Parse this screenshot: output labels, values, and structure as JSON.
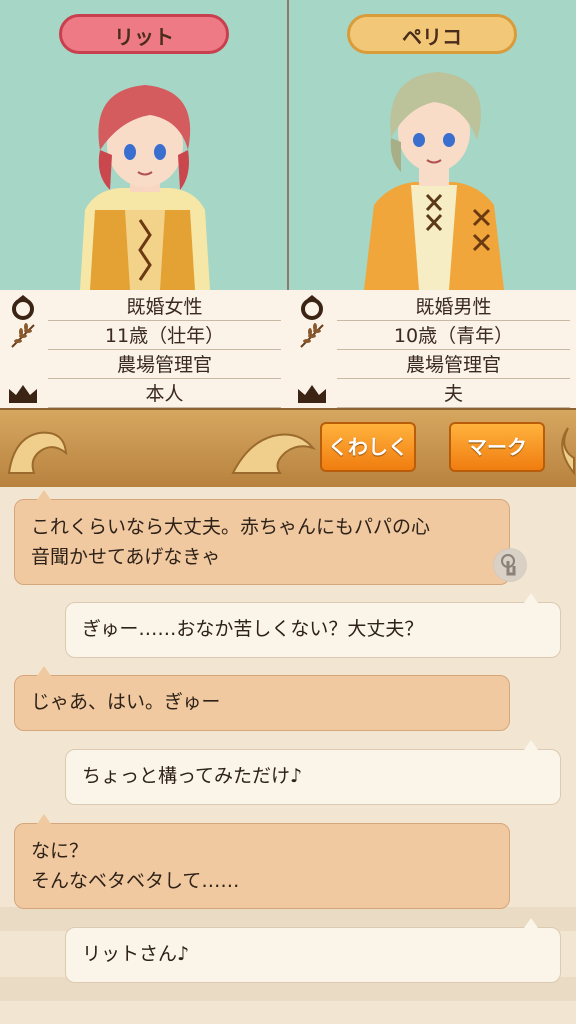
{
  "left_character": {
    "name": "リット",
    "status": "既婚女性",
    "age": "11歳（壮年）",
    "job": "農場管理官",
    "relation": "本人"
  },
  "right_character": {
    "name": "ペリコ",
    "status": "既婚男性",
    "age": "10歳（青年）",
    "job": "農場管理官",
    "relation": "夫"
  },
  "icons": [
    "ring-icon",
    "wheat-icon",
    "crown-icon",
    "tap-icon"
  ],
  "buttons": {
    "detail": "くわしく",
    "mark": "マーク"
  },
  "messages": [
    {
      "side": "left",
      "text": "これくらいなら大丈夫。赤ちゃんにもパパの心\n音聞かせてあげなきゃ"
    },
    {
      "side": "right",
      "text": "ぎゅー……おなか苦しくない？大丈夫？"
    },
    {
      "side": "left",
      "text": "じゃあ、はい。ぎゅー"
    },
    {
      "side": "right",
      "text": "ちょっと構ってみただけ♪"
    },
    {
      "side": "left",
      "text": "なに？\nそんなベタベタして……"
    },
    {
      "side": "right",
      "text": "リットさん♪"
    }
  ],
  "colors": {
    "left_tag": "#ee7a85",
    "right_tag": "#f3c778",
    "button": "#f59520",
    "portrait_bg": "#a6d6c6"
  }
}
